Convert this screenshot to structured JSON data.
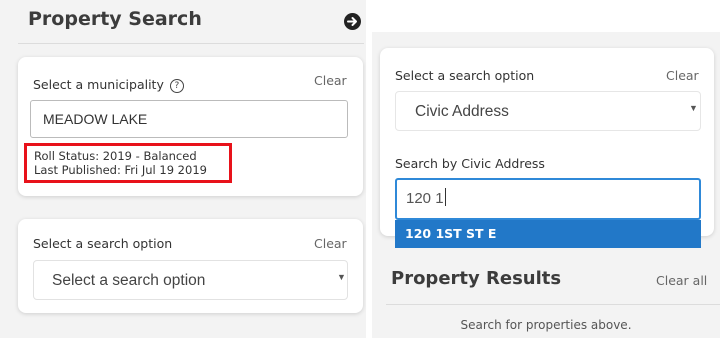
{
  "left_panel": {
    "title": "Property Search",
    "municipality_card": {
      "label": "Select a municipality",
      "help_glyph": "?",
      "clear_label": "Clear",
      "input_value": "MEADOW LAKE",
      "roll_status": "Roll Status:  2019 - Balanced",
      "last_published": "Last Published:  Fri Jul 19 2019"
    },
    "search_option_card": {
      "label": "Select a search option",
      "clear_label": "Clear",
      "selected_value": "Select a search option"
    }
  },
  "right_panel": {
    "search_option_card": {
      "label": "Select a search option",
      "clear_label": "Clear",
      "selected_value": "Civic Address",
      "address_label": "Search by Civic Address",
      "address_value": "120 1",
      "suggestions": [
        "120 1ST ST E"
      ]
    },
    "results": {
      "title": "Property Results",
      "clear_all_label": "Clear all",
      "empty_message": "Search for properties above."
    }
  },
  "icons": {
    "next": "arrow-right-circle-icon",
    "help": "question-circle-icon",
    "caret": "caret-down-icon"
  },
  "colors": {
    "highlight_border": "#e8121a",
    "focus_border": "#2f89d8",
    "suggestion_bg": "#2278c8"
  }
}
